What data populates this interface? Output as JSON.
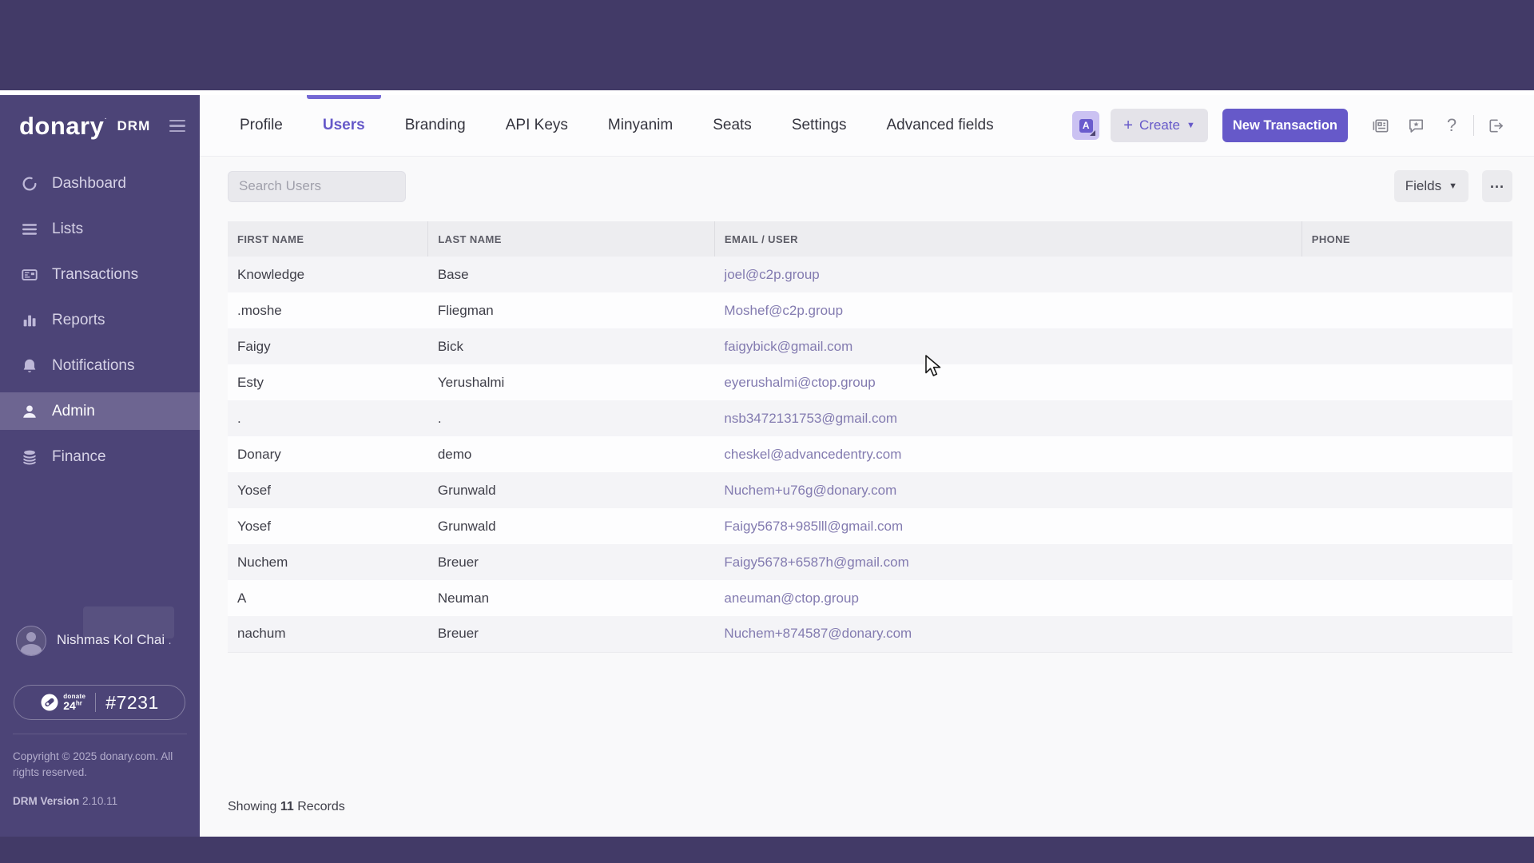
{
  "colors": {
    "band": "#423a67",
    "sidebar": "#4c4477",
    "sidebar_active": "#6d6591",
    "accent": "#6659c9",
    "accent_light": "#7468d4",
    "email_link": "#837bb0"
  },
  "brand": {
    "name": "donary",
    "product": "DRM"
  },
  "sidebar": {
    "items": [
      {
        "icon": "dashboard-icon",
        "label": "Dashboard",
        "active": false
      },
      {
        "icon": "lists-icon",
        "label": "Lists",
        "active": false
      },
      {
        "icon": "transactions-icon",
        "label": "Transactions",
        "active": false
      },
      {
        "icon": "reports-icon",
        "label": "Reports",
        "active": false
      },
      {
        "icon": "notifications-icon",
        "label": "Notifications",
        "active": false
      },
      {
        "icon": "admin-icon",
        "label": "Admin",
        "active": true
      },
      {
        "icon": "finance-icon",
        "label": "Finance",
        "active": false
      }
    ],
    "user": {
      "name": "Nishmas Kol Chai",
      "subtitle": "."
    },
    "badge": {
      "logo_line1": "donate",
      "logo_line2": "24",
      "logo_sup": "hr",
      "number": "#7231"
    },
    "copyright_line1": "Copyright © 2025 donary.com. All",
    "copyright_line2": "rights reserved.",
    "version_label": "DRM Version",
    "version_value": "2.10.11"
  },
  "header": {
    "tabs": [
      {
        "label": "Profile",
        "active": false
      },
      {
        "label": "Users",
        "active": true
      },
      {
        "label": "Branding",
        "active": false
      },
      {
        "label": "API Keys",
        "active": false
      },
      {
        "label": "Minyanim",
        "active": false
      },
      {
        "label": "Seats",
        "active": false
      },
      {
        "label": "Settings",
        "active": false
      },
      {
        "label": "Advanced fields",
        "active": false
      }
    ],
    "create_label": "Create",
    "new_transaction_label": "New Transaction",
    "icon_buttons": [
      {
        "icon": "news-icon"
      },
      {
        "icon": "feedback-icon"
      },
      {
        "icon": "help-icon",
        "glyph": "?"
      },
      {
        "icon": "logout-icon"
      }
    ]
  },
  "toolbar": {
    "search_placeholder": "Search Users",
    "fields_label": "Fields",
    "more_label": "..."
  },
  "table": {
    "columns": [
      "FIRST NAME",
      "LAST NAME",
      "EMAIL / USER",
      "PHONE"
    ],
    "rows": [
      {
        "first": "Knowledge",
        "last": "Base",
        "email": "joel@c2p.group",
        "phone": ""
      },
      {
        "first": ".moshe",
        "last": "Fliegman",
        "email": "Moshef@c2p.group",
        "phone": ""
      },
      {
        "first": "Faigy",
        "last": "Bick",
        "email": "faigybick@gmail.com",
        "phone": ""
      },
      {
        "first": "Esty",
        "last": "Yerushalmi",
        "email": "eyerushalmi@ctop.group",
        "phone": ""
      },
      {
        "first": ".",
        "last": ".",
        "email": "nsb3472131753@gmail.com",
        "phone": ""
      },
      {
        "first": "Donary",
        "last": "demo",
        "email": "cheskel@advancedentry.com",
        "phone": ""
      },
      {
        "first": "Yosef",
        "last": "Grunwald",
        "email": "Nuchem+u76g@donary.com",
        "phone": ""
      },
      {
        "first": "Yosef",
        "last": "Grunwald",
        "email": "Faigy5678+985lll@gmail.com",
        "phone": ""
      },
      {
        "first": "Nuchem",
        "last": "Breuer",
        "email": "Faigy5678+6587h@gmail.com",
        "phone": ""
      },
      {
        "first": "A",
        "last": "Neuman",
        "email": "aneuman@ctop.group",
        "phone": ""
      },
      {
        "first": "nachum",
        "last": "Breuer",
        "email": "Nuchem+874587@donary.com",
        "phone": ""
      }
    ]
  },
  "footer": {
    "showing_prefix": "Showing",
    "count": "11",
    "showing_suffix": "Records"
  }
}
